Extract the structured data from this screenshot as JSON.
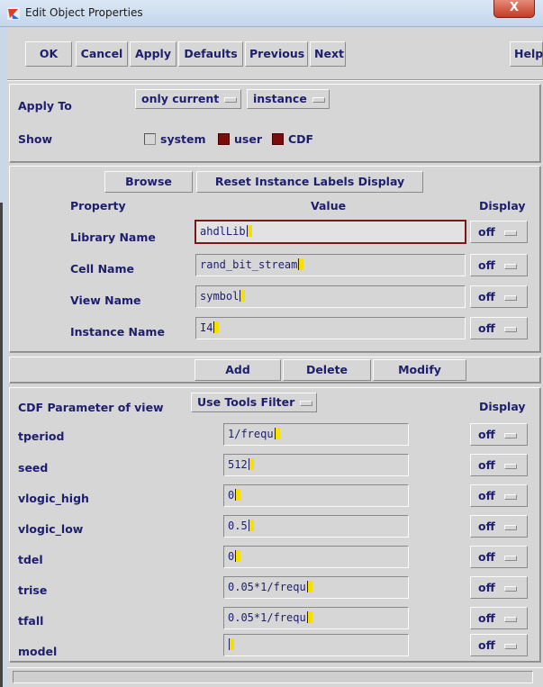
{
  "window": {
    "title": "Edit Object Properties",
    "close_glyph": "X"
  },
  "toolbar": {
    "ok": "OK",
    "cancel": "Cancel",
    "apply": "Apply",
    "defaults": "Defaults",
    "previous": "Previous",
    "next": "Next",
    "help": "Help"
  },
  "apply_section": {
    "apply_to_label": "Apply To",
    "apply_to_scope": "only current",
    "apply_to_object": "instance",
    "show_label": "Show",
    "show_options": [
      {
        "label": "system",
        "checked": false
      },
      {
        "label": "user",
        "checked": true
      },
      {
        "label": "CDF",
        "checked": true
      }
    ]
  },
  "instance_section": {
    "browse": "Browse",
    "reset_labels": "Reset Instance Labels Display",
    "headers": {
      "property": "Property",
      "value": "Value",
      "display": "Display"
    },
    "rows": [
      {
        "label": "Library Name",
        "value": "ahdlLib",
        "display": "off"
      },
      {
        "label": "Cell Name",
        "value": "rand_bit_stream",
        "display": "off"
      },
      {
        "label": "View Name",
        "value": "symbol",
        "display": "off"
      },
      {
        "label": "Instance Name",
        "value": "I4",
        "display": "off"
      }
    ]
  },
  "edit_actions": {
    "add": "Add",
    "delete": "Delete",
    "modify": "Modify"
  },
  "cdf_section": {
    "header_label": "CDF Parameter of view",
    "filter": "Use Tools Filter",
    "display_header": "Display",
    "params": [
      {
        "label": "tperiod",
        "value": "1/frequ",
        "display": "off"
      },
      {
        "label": "seed",
        "value": "512",
        "display": "off"
      },
      {
        "label": "vlogic_high",
        "value": "0",
        "display": "off"
      },
      {
        "label": "vlogic_low",
        "value": "0.5",
        "display": "off"
      },
      {
        "label": "tdel",
        "value": "0",
        "display": "off"
      },
      {
        "label": "trise",
        "value": "0.05*1/frequ",
        "display": "off"
      },
      {
        "label": "tfall",
        "value": "0.05*1/frequ",
        "display": "off"
      },
      {
        "label": "model",
        "value": "",
        "display": "off"
      }
    ]
  },
  "colors": {
    "panel_bg": "#d6d6d6",
    "text": "#1e1e6e",
    "checked": "#7a0c0c",
    "cursor": "#f5e000",
    "focus_border": "#7a1818"
  }
}
